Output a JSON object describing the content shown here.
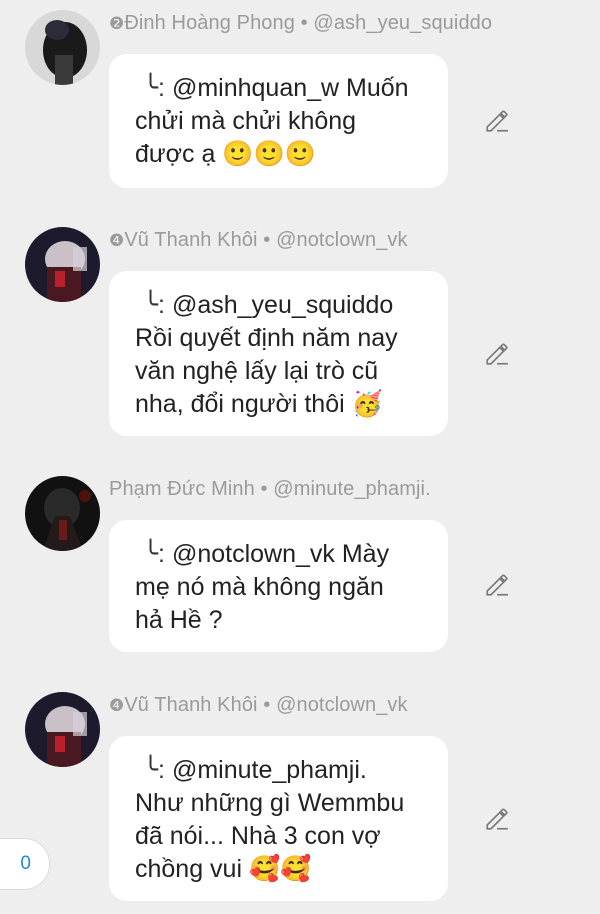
{
  "comments": [
    {
      "rank": "❷",
      "name": "Đinh Hoàng Phong",
      "sep": "•",
      "handle": "@ash_yeu_squiddo",
      "reply_marker": "╰:",
      "text_lines": [
        "@minhquan_w Muốn",
        "chửi mà chửi không",
        "được ạ 🙂🙂🙂"
      ]
    },
    {
      "rank": "❹",
      "name": "Vũ Thanh Khôi",
      "sep": "•",
      "handle": "@notclown_vk",
      "reply_marker": "╰:",
      "text_lines": [
        "@ash_yeu_squiddo",
        "Rồi quyết định năm nay",
        "văn nghệ lấy lại trò cũ",
        "nha, đổi người thôi 🥳"
      ]
    },
    {
      "rank": "",
      "name": "Phạm Đức Minh",
      "sep": "•",
      "handle": "@minute_phamji.",
      "reply_marker": "╰:",
      "text_lines": [
        "@notclown_vk Mày",
        "mẹ nó mà không ngăn",
        "hả Hề ?"
      ]
    },
    {
      "rank": "❹",
      "name": "Vũ Thanh Khôi",
      "sep": "•",
      "handle": "@notclown_vk",
      "reply_marker": "╰:",
      "text_lines": [
        "@minute_phamji.",
        "Như những gì Wemmbu",
        "đã nói... Nhà 3 con vợ",
        "chồng vui 🥰🥰"
      ]
    }
  ],
  "icons": {
    "edit": "pencil-icon"
  },
  "counter": {
    "value": "0"
  },
  "colors": {
    "background": "#eeeeee",
    "bubble": "#ffffff",
    "meta": "#9a9a9a",
    "accent": "#1e88e5"
  }
}
